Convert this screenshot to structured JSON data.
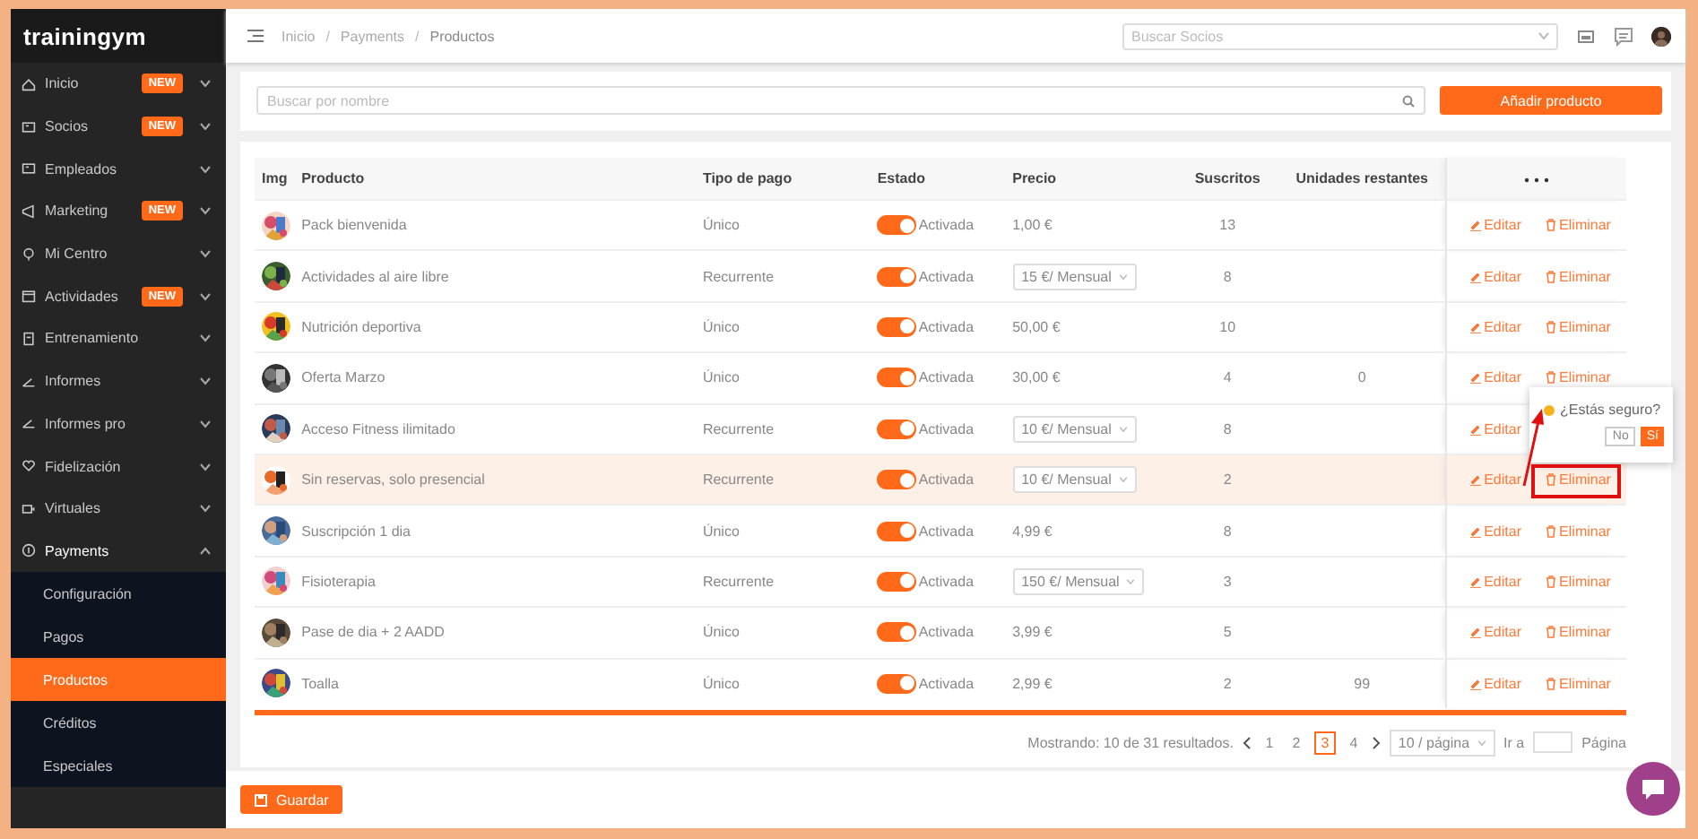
{
  "brand": "trainingym",
  "sidebar": {
    "items": [
      {
        "label": "Inicio",
        "badge": "NEW",
        "expanded": false
      },
      {
        "label": "Socios",
        "badge": "NEW",
        "expanded": false
      },
      {
        "label": "Empleados",
        "expanded": false
      },
      {
        "label": "Marketing",
        "badge": "NEW",
        "expanded": false
      },
      {
        "label": "Mi Centro",
        "expanded": false
      },
      {
        "label": "Actividades",
        "badge": "NEW",
        "expanded": false
      },
      {
        "label": "Entrenamiento",
        "expanded": false
      },
      {
        "label": "Informes",
        "expanded": false
      },
      {
        "label": "Informes pro",
        "expanded": false
      },
      {
        "label": "Fidelización",
        "expanded": false
      },
      {
        "label": "Virtuales",
        "expanded": false
      },
      {
        "label": "Payments",
        "expanded": true,
        "children": [
          {
            "label": "Configuración",
            "selected": false
          },
          {
            "label": "Pagos",
            "selected": false
          },
          {
            "label": "Productos",
            "selected": true
          },
          {
            "label": "Créditos",
            "selected": false
          },
          {
            "label": "Especiales",
            "selected": false
          }
        ]
      }
    ]
  },
  "breadcrumb": [
    {
      "label": "Inicio",
      "separator": "/"
    },
    {
      "label": "Payments",
      "separator": "/"
    },
    {
      "label": "Productos"
    }
  ],
  "member_search": {
    "placeholder": "Buscar Socios"
  },
  "product_search": {
    "placeholder": "Buscar por nombre"
  },
  "add_button": "Añadir producto",
  "table": {
    "columns": [
      "Img",
      "Producto",
      "Tipo de pago",
      "Estado",
      "Precio",
      "Suscritos",
      "Unidades restantes"
    ],
    "rows": [
      {
        "name": "Pack bienvenida",
        "payment": "Único",
        "on": true,
        "status": "Activada",
        "price": "1,00 €",
        "kind": "text",
        "subscribed": "13",
        "edit": "Editar",
        "delete": "Eliminar",
        "highlighted": false
      },
      {
        "name": "Actividades al aire libre",
        "payment": "Recurrente",
        "on": true,
        "status": "Activada",
        "price": "15 €/ Mensual",
        "kind": "select",
        "subscribed": "8",
        "edit": "Editar",
        "delete": "Eliminar",
        "highlighted": false
      },
      {
        "name": "Nutrición deportiva",
        "payment": "Único",
        "on": true,
        "status": "Activada",
        "price": "50,00 €",
        "kind": "text",
        "subscribed": "10",
        "edit": "Editar",
        "delete": "Eliminar",
        "highlighted": false
      },
      {
        "name": "Oferta Marzo",
        "payment": "Único",
        "on": true,
        "status": "Activada",
        "price": "30,00 €",
        "kind": "text",
        "subscribed": "4",
        "units": "0",
        "edit": "Editar",
        "delete": "Eliminar",
        "highlighted": false
      },
      {
        "name": "Acceso Fitness ilimitado",
        "payment": "Recurrente",
        "on": true,
        "status": "Activada",
        "price": "10 €/ Mensual",
        "kind": "select",
        "subscribed": "8",
        "edit": "Editar",
        "highlighted": false
      },
      {
        "name": "Sin reservas, solo presencial",
        "payment": "Recurrente",
        "on": true,
        "status": "Activada",
        "price": "10 €/ Mensual",
        "kind": "select",
        "subscribed": "2",
        "edit": "Editar",
        "delete": "Eliminar",
        "highlighted": true
      },
      {
        "name": "Suscripción 1 dia",
        "payment": "Único",
        "on": true,
        "status": "Activada",
        "price": "4,99 €",
        "kind": "text",
        "subscribed": "8",
        "edit": "Editar",
        "delete": "Eliminar",
        "highlighted": false
      },
      {
        "name": "Fisioterapia",
        "payment": "Recurrente",
        "on": true,
        "status": "Activada",
        "price": "150 €/ Mensual",
        "kind": "select",
        "subscribed": "3",
        "edit": "Editar",
        "delete": "Eliminar",
        "highlighted": false
      },
      {
        "name": "Pase de dia + 2 AADD",
        "payment": "Único",
        "on": true,
        "status": "Activada",
        "price": "3,99 €",
        "kind": "text",
        "subscribed": "5",
        "edit": "Editar",
        "delete": "Eliminar",
        "highlighted": false
      },
      {
        "name": "Toalla",
        "payment": "Único",
        "on": true,
        "status": "Activada",
        "price": "2,99 €",
        "kind": "text",
        "subscribed": "2",
        "units": "99",
        "edit": "Editar",
        "delete": "Eliminar",
        "highlighted": false
      }
    ]
  },
  "popconfirm": {
    "message": "¿Estás seguro?",
    "buttons": [
      "No",
      "Sí"
    ]
  },
  "pagination": {
    "summary": "Mostrando: 10 de 31 resultados.",
    "pages": [
      {
        "label": "1",
        "selected": false
      },
      {
        "label": "2",
        "selected": false
      },
      {
        "label": "3",
        "selected": true
      },
      {
        "label": "4",
        "selected": false
      }
    ],
    "page_size": "10 / página",
    "goto_label": "Ir a",
    "goto_suffix": "Página"
  },
  "save_button": "Guardar"
}
